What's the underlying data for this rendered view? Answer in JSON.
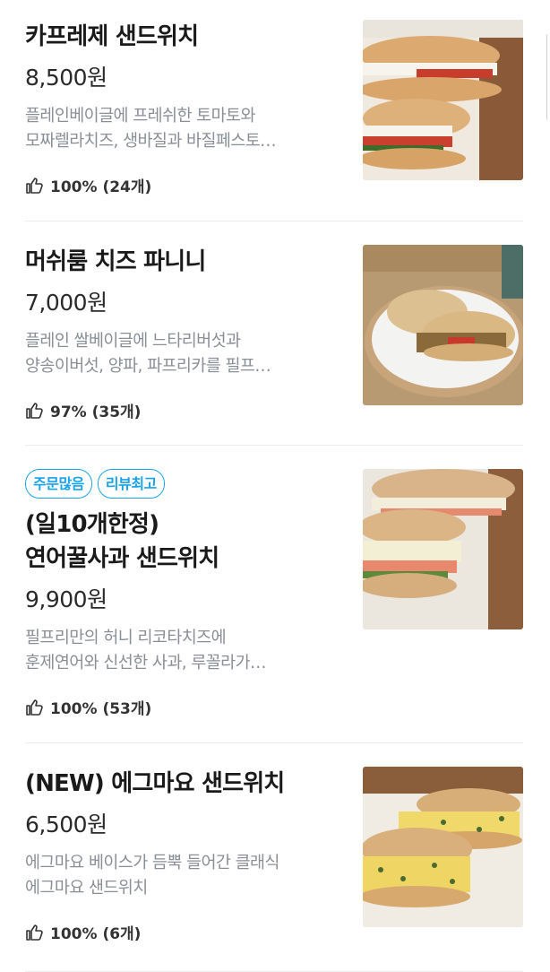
{
  "colors": {
    "badge": "#1aa3e8",
    "description": "#8a8f96",
    "divider": "#ececec"
  },
  "rating_icon": "thumbs-up-icon",
  "menu": [
    {
      "name": "카프레제 샌드위치",
      "price": "8,500원",
      "description": "플레인베이글에 프레쉬한 토마토와\n모짜렐라치즈, 생바질과 바질페스토…",
      "rating": "100% (24개)",
      "badges": [],
      "photo_icon": "caprese-sandwich-photo"
    },
    {
      "name": "머쉬룸 치즈 파니니",
      "price": "7,000원",
      "description": "플레인 쌀베이글에 느타리버섯과\n양송이버섯, 양파, 파프리카를 필프…",
      "rating": "97% (35개)",
      "badges": [],
      "photo_icon": "mushroom-panini-photo"
    },
    {
      "name": "(일10개한정)\n연어꿀사과 샌드위치",
      "price": "9,900원",
      "description": "필프리만의 허니 리코타치즈에\n훈제연어와 신선한 사과, 루꼴라가…",
      "rating": "100% (53개)",
      "badges": [
        "주문많음",
        "리뷰최고"
      ],
      "photo_icon": "salmon-apple-sandwich-photo"
    },
    {
      "name": "(NEW) 에그마요 샌드위치",
      "price": "6,500원",
      "description": "에그마요 베이스가 듬뿍 들어간 클래식\n에그마요 샌드위치",
      "rating": "100% (6개)",
      "badges": [],
      "photo_icon": "egg-mayo-sandwich-photo"
    }
  ]
}
